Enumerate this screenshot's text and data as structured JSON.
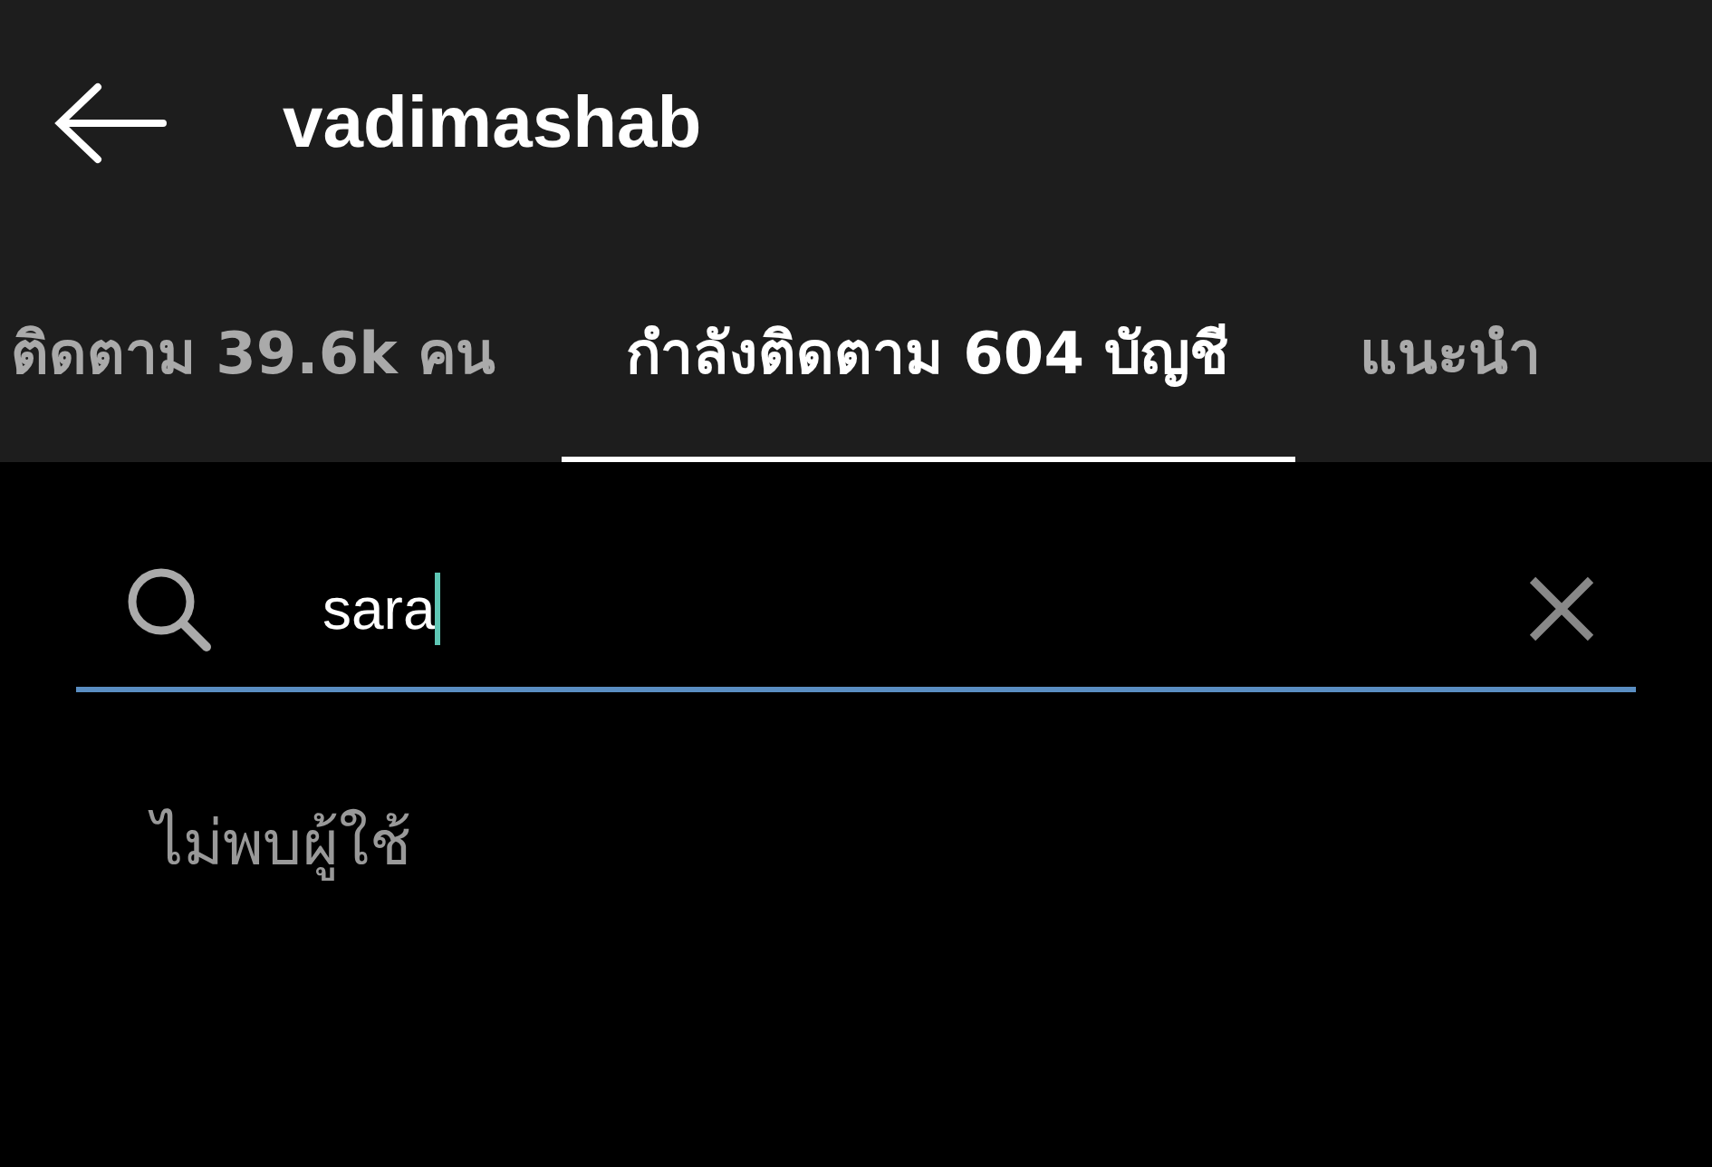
{
  "header": {
    "title": "vadimashab"
  },
  "tabs": [
    {
      "label": "ติดตาม 39.6k คน",
      "selected": false
    },
    {
      "label": "กำลังติดตาม 604 บัญชี",
      "selected": true
    },
    {
      "label": "แนะนำ",
      "selected": false
    }
  ],
  "search": {
    "value": "sara"
  },
  "message": "ไม่พบผู้ใช้"
}
